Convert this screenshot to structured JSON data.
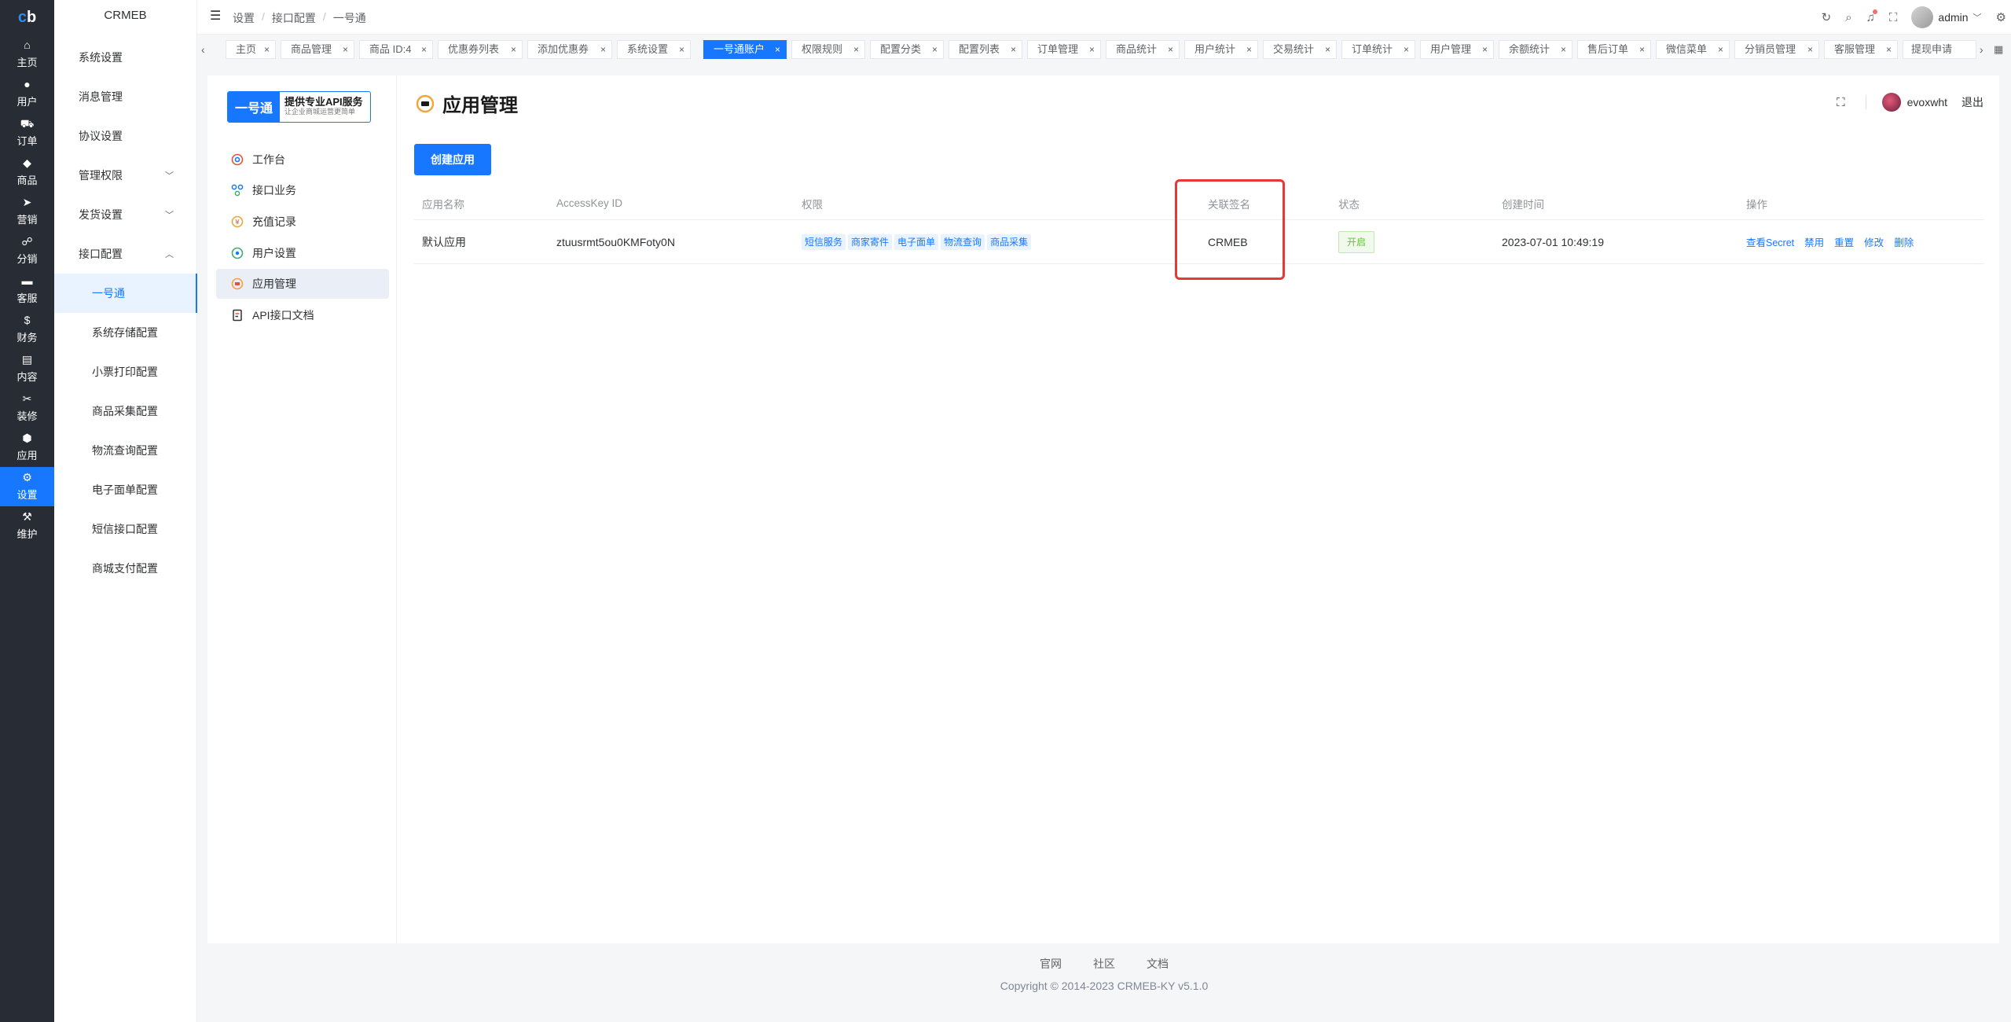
{
  "rail": {
    "logo_prefix": "c",
    "logo_suffix": "b",
    "items": [
      {
        "label": "主页",
        "icon": "home-icon",
        "glyph": "⌂"
      },
      {
        "label": "用户",
        "icon": "user-icon",
        "glyph": "●"
      },
      {
        "label": "订单",
        "icon": "cart-icon",
        "glyph": "⛟"
      },
      {
        "label": "商品",
        "icon": "bag-icon",
        "glyph": "◆"
      },
      {
        "label": "营销",
        "icon": "send-icon",
        "glyph": "➤"
      },
      {
        "label": "分销",
        "icon": "share-icon",
        "glyph": "☍"
      },
      {
        "label": "客服",
        "icon": "chat-icon",
        "glyph": "▬"
      },
      {
        "label": "财务",
        "icon": "dollar-icon",
        "glyph": "$"
      },
      {
        "label": "内容",
        "icon": "book-icon",
        "glyph": "▤"
      },
      {
        "label": "装修",
        "icon": "tools-icon",
        "glyph": "✂"
      },
      {
        "label": "应用",
        "icon": "cube-icon",
        "glyph": "⬢"
      },
      {
        "label": "设置",
        "icon": "gear-icon",
        "glyph": "⚙"
      },
      {
        "label": "维护",
        "icon": "hammer-icon",
        "glyph": "⚒"
      }
    ]
  },
  "submenu": {
    "brand": "CRMEB",
    "items": [
      {
        "label": "系统设置"
      },
      {
        "label": "消息管理"
      },
      {
        "label": "协议设置"
      },
      {
        "label": "管理权限",
        "arrow": "﹀"
      },
      {
        "label": "发货设置",
        "arrow": "﹀"
      },
      {
        "label": "接口配置",
        "arrow": "︿"
      },
      {
        "label": "一号通"
      },
      {
        "label": "系统存储配置"
      },
      {
        "label": "小票打印配置"
      },
      {
        "label": "商品采集配置"
      },
      {
        "label": "物流查询配置"
      },
      {
        "label": "电子面单配置"
      },
      {
        "label": "短信接口配置"
      },
      {
        "label": "商城支付配置"
      }
    ]
  },
  "header": {
    "breadcrumb": [
      "设置",
      "接口配置",
      "一号通"
    ],
    "separator": "/",
    "username": "admin"
  },
  "tabs": {
    "left_arrow": "‹",
    "right_arrow": "›",
    "items": [
      "主页",
      "商品管理",
      "商品 ID:4",
      "优惠券列表",
      "添加优惠券",
      "系统设置",
      "一号通账户",
      "权限规则",
      "配置分类",
      "配置列表",
      "订单管理",
      "商品统计",
      "用户统计",
      "交易统计",
      "订单统计",
      "用户管理",
      "余额统计",
      "售后订单",
      "微信菜单",
      "分销员管理",
      "客服管理",
      "提现申请"
    ],
    "close": "×"
  },
  "leftpanel": {
    "banner_left": "一号通",
    "banner_title": "提供专业API服务",
    "banner_sub": "让企业商城运营更简单",
    "items": [
      "工作台",
      "接口业务",
      "充值记录",
      "用户设置",
      "应用管理",
      "API接口文档"
    ]
  },
  "main": {
    "title": "应用管理",
    "account": "evoxwht",
    "logout": "退出",
    "create_button": "创建应用",
    "columns": [
      "应用名称",
      "AccessKey ID",
      "权限",
      "关联签名",
      "状态",
      "创建时间",
      "操作"
    ],
    "rows": [
      {
        "name": "默认应用",
        "access_key": "ztuusrmt5ou0KMFoty0N",
        "permissions": [
          "短信服务",
          "商家寄件",
          "电子面单",
          "物流查询",
          "商品采集"
        ],
        "signature": "CRMEB",
        "status": "开启",
        "created": "2023-07-01 10:49:19",
        "actions": [
          "查看Secret",
          "禁用",
          "重置",
          "修改",
          "删除"
        ]
      }
    ]
  },
  "footer": {
    "links": [
      "官网",
      "社区",
      "文档"
    ],
    "copyright": "Copyright © 2014-2023 CRMEB-KY v5.1.0"
  },
  "colors": {
    "primary": "#1877ff",
    "rail_bg": "#282c34",
    "highlight": "#e53935",
    "status_green": "#67c23a"
  }
}
